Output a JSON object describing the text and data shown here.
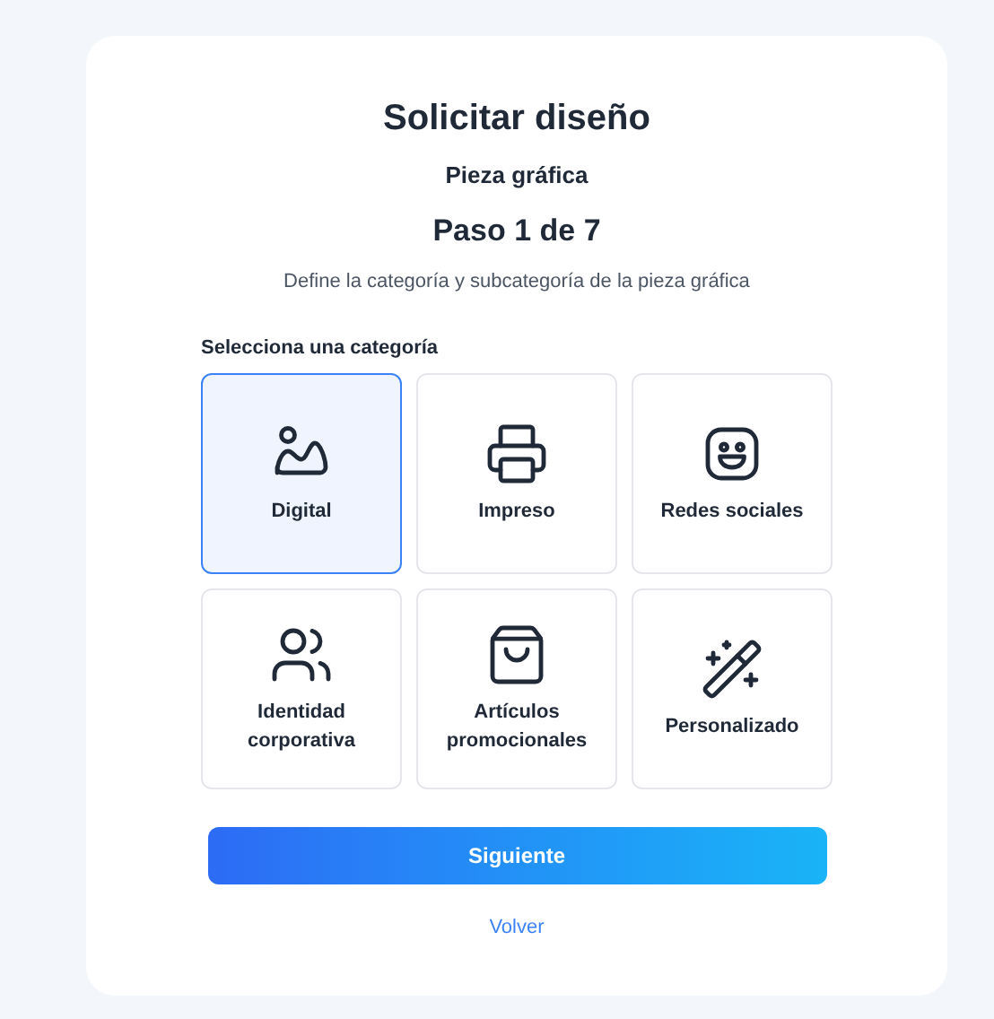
{
  "title": "Solicitar diseño",
  "subtitle": "Pieza gráfica",
  "step": "Paso 1 de 7",
  "description": "Define la categoría y subcategoría de la pieza gráfica",
  "section_label": "Selecciona una categoría",
  "categories": [
    {
      "label": "Digital",
      "selected": true
    },
    {
      "label": "Impreso",
      "selected": false
    },
    {
      "label": "Redes sociales",
      "selected": false
    },
    {
      "label": "Identidad corporativa",
      "selected": false
    },
    {
      "label": "Artículos promocionales",
      "selected": false
    },
    {
      "label": "Personalizado",
      "selected": false
    }
  ],
  "primary_button": "Siguiente",
  "back_link": "Volver"
}
